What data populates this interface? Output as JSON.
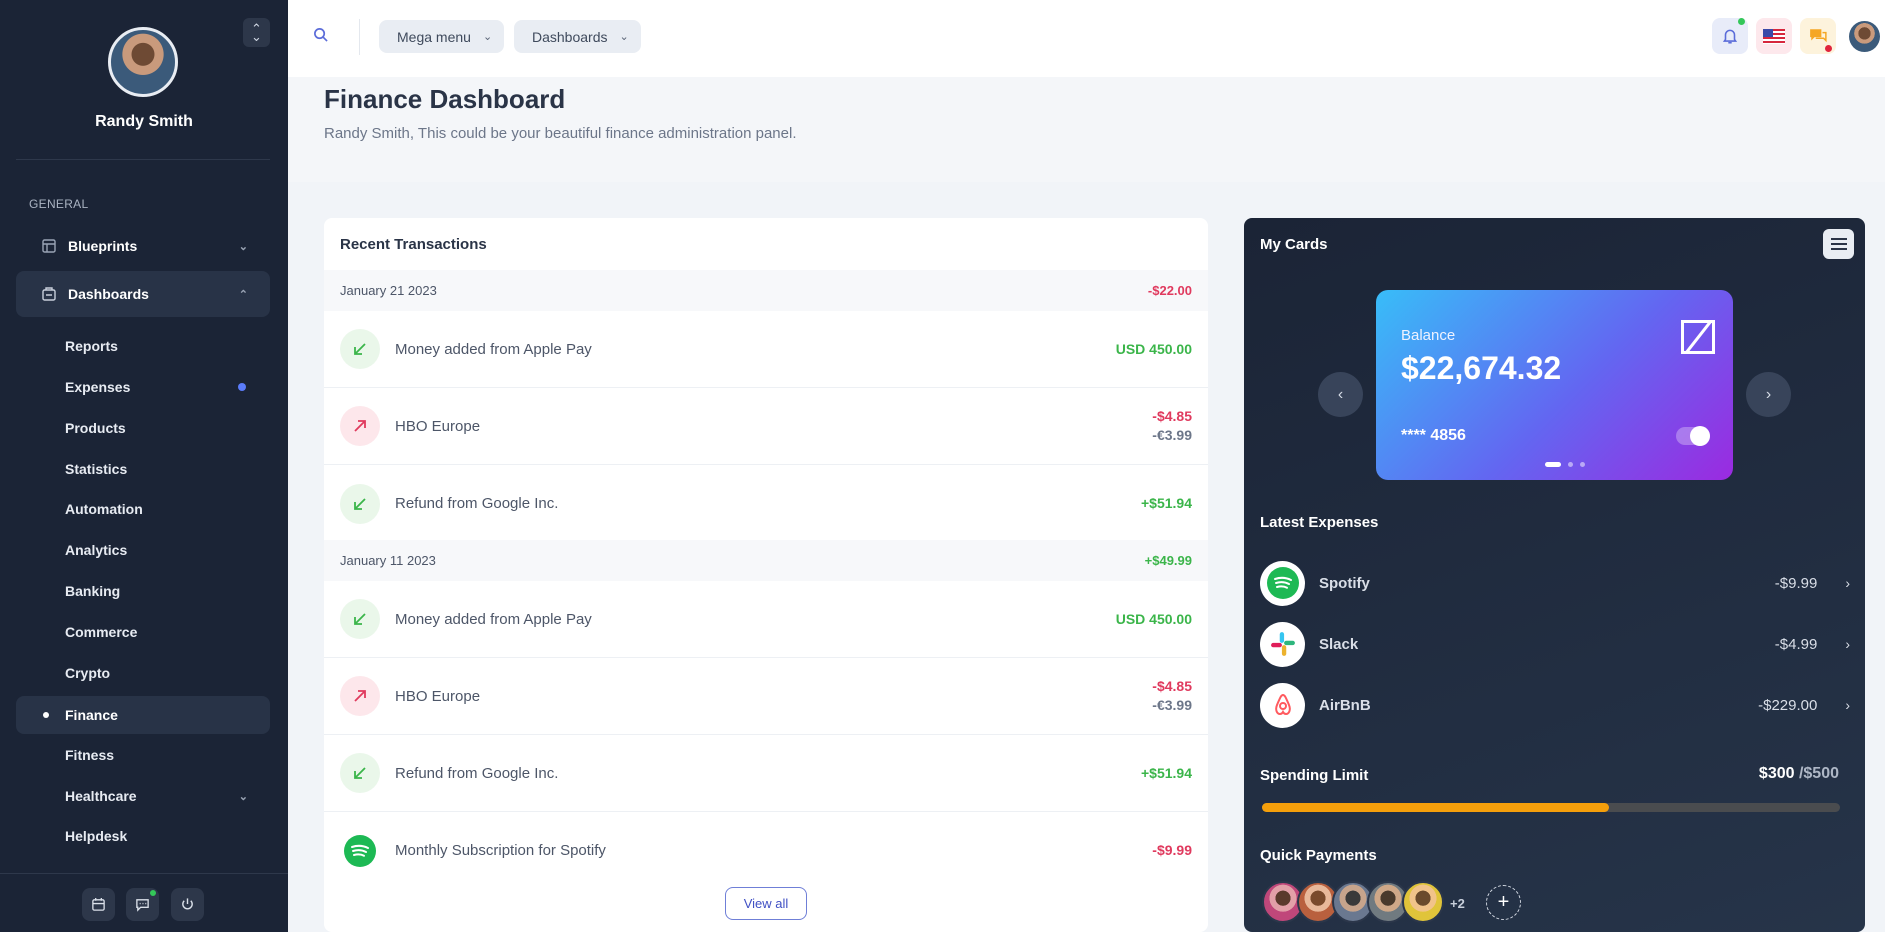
{
  "user": {
    "name": "Randy Smith"
  },
  "sidebar": {
    "section_label": "GENERAL",
    "groups": [
      {
        "label": "Blueprints",
        "icon": "blueprint-icon"
      },
      {
        "label": "Dashboards",
        "icon": "dashboard-icon"
      }
    ],
    "items": [
      {
        "label": "Reports"
      },
      {
        "label": "Expenses"
      },
      {
        "label": "Products"
      },
      {
        "label": "Statistics"
      },
      {
        "label": "Automation"
      },
      {
        "label": "Analytics"
      },
      {
        "label": "Banking"
      },
      {
        "label": "Commerce"
      },
      {
        "label": "Crypto"
      },
      {
        "label": "Finance"
      },
      {
        "label": "Fitness"
      },
      {
        "label": "Healthcare"
      },
      {
        "label": "Helpdesk"
      }
    ]
  },
  "topbar": {
    "mega_menu": "Mega menu",
    "dashboards": "Dashboards"
  },
  "page": {
    "title": "Finance Dashboard",
    "subtitle": "Randy Smith, This could be your beautiful finance administration panel."
  },
  "transactions": {
    "title": "Recent Transactions",
    "groups": [
      {
        "date": "January 21 2023",
        "total": "-$22.00",
        "rows": [
          {
            "desc": "Money added from Apple Pay",
            "amount": "USD 450.00",
            "secondary": ""
          },
          {
            "desc": "HBO Europe",
            "amount": "-$4.85",
            "secondary": "-€3.99"
          },
          {
            "desc": "Refund from Google Inc.",
            "amount": "+$51.94",
            "secondary": ""
          }
        ]
      },
      {
        "date": "January 11 2023",
        "total": "+$49.99",
        "rows": [
          {
            "desc": "Money added from Apple Pay",
            "amount": "USD 450.00",
            "secondary": ""
          },
          {
            "desc": "HBO Europe",
            "amount": "-$4.85",
            "secondary": "-€3.99"
          },
          {
            "desc": "Refund from Google Inc.",
            "amount": "+$51.94",
            "secondary": ""
          },
          {
            "desc": "Monthly Subscription for Spotify",
            "amount": "-$9.99",
            "secondary": ""
          }
        ]
      }
    ],
    "view_all": "View all"
  },
  "cards": {
    "title": "My Cards",
    "card": {
      "label": "Balance",
      "balance": "$22,674.32",
      "number": "**** 4856"
    },
    "latest_title": "Latest Expenses",
    "expenses": [
      {
        "name": "Spotify",
        "value": "-$9.99"
      },
      {
        "name": "Slack",
        "value": "-$4.99"
      },
      {
        "name": "AirBnB",
        "value": "-$229.00"
      }
    ],
    "limit_title": "Spending Limit",
    "limit_used": "$300",
    "limit_max": " /$500",
    "limit_fraction": 0.6,
    "quick_title": "Quick Payments",
    "quick_more": "+2"
  }
}
